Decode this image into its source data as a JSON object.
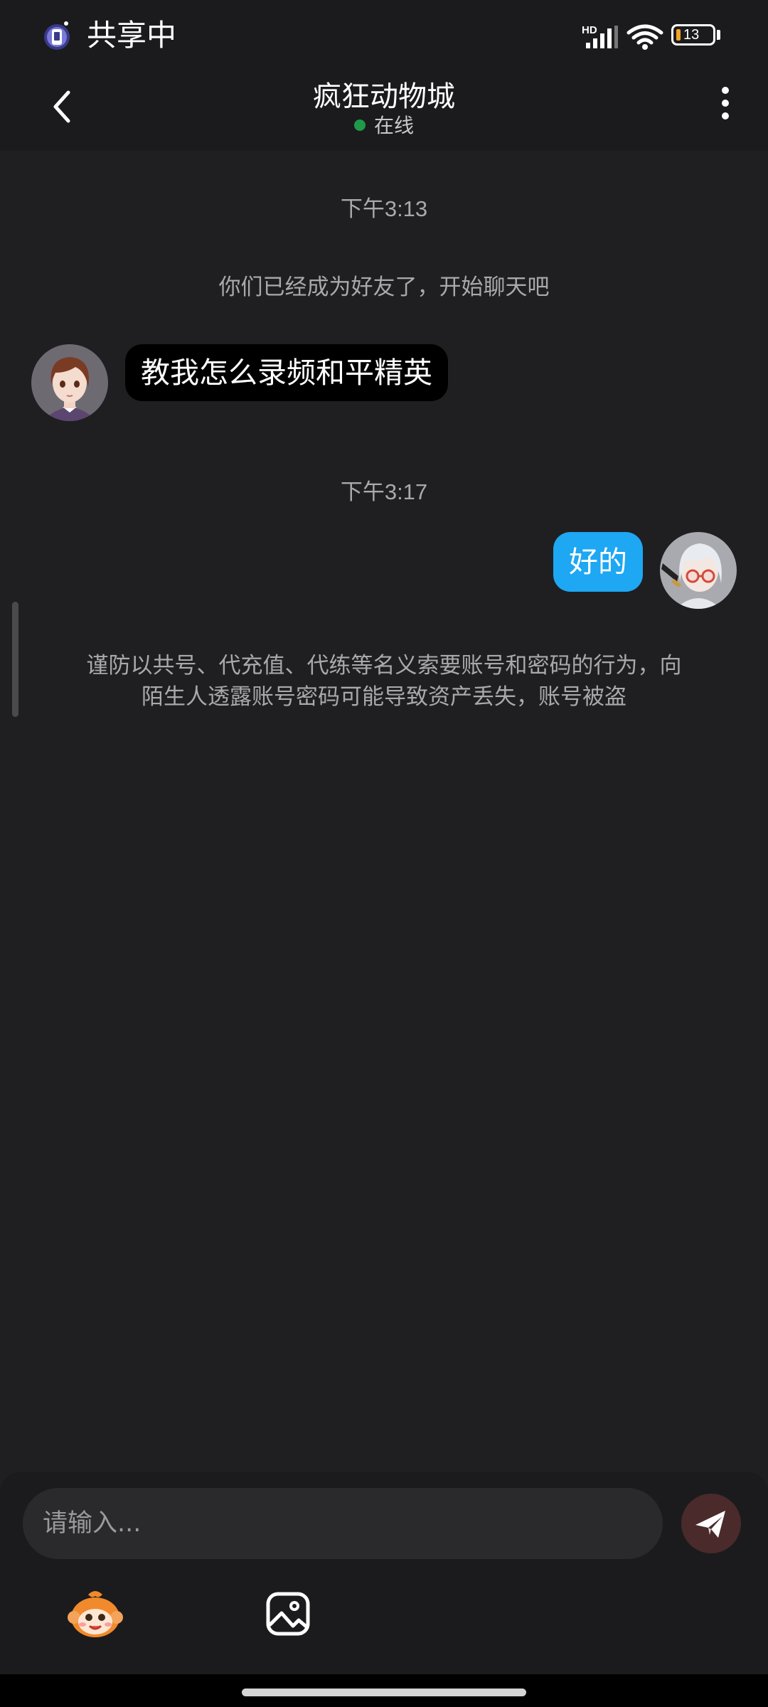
{
  "status_bar": {
    "share_text": "共享中",
    "network_label": "HD",
    "battery_level": "13",
    "battery_color": "#f2a42a"
  },
  "header": {
    "title": "疯狂动物城",
    "status": "在线",
    "status_color": "#1f9a4a"
  },
  "messages": {
    "time1": "下午3:13",
    "system_note": "你们已经成为好友了，开始聊天吧",
    "incoming_text": "教我怎么录频和平精英",
    "time2": "下午3:17",
    "outgoing_text": "好的",
    "warning_line1": "谨防以共号、代充值、代练等名义索要账号和密码的行为，向",
    "warning_line2": "陌生人透露账号密码可能导致资产丢失，账号被盗"
  },
  "input": {
    "placeholder": "请输入..."
  },
  "colors": {
    "background": "#1f1f21",
    "incoming_bubble": "#000000",
    "outgoing_bubble": "#1ea7f2"
  },
  "icons": {
    "back": "chevron-left-icon",
    "more": "vertical-dots-icon",
    "send": "paper-plane-icon",
    "emoji": "monkey-emoji-icon",
    "image": "image-icon"
  }
}
